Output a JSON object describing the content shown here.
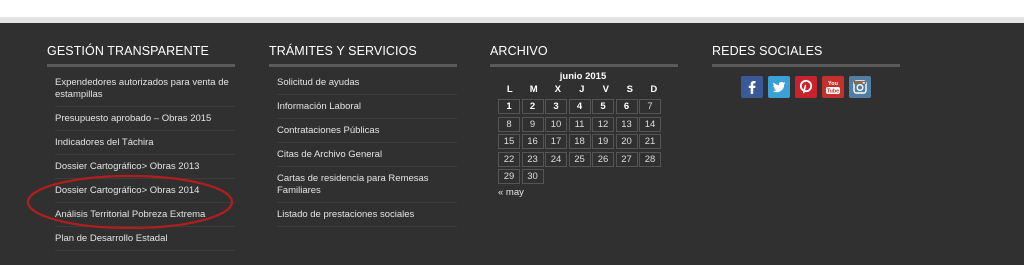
{
  "colors": {
    "footer_bg": "#303030",
    "rule": "#5a5a5a",
    "annotation": "#b21e1e",
    "facebook": "#3b5998",
    "twitter": "#3aa0d6",
    "pinterest": "#c8232c",
    "youtube": "#c4302b",
    "instagram": "#517fa4"
  },
  "gestion": {
    "title": "GESTIÓN TRANSPARENTE",
    "items": [
      "Expendedores autorizados para venta de estampillas",
      "Presupuesto aprobado – Obras 2015",
      "Indicadores del Táchira",
      "Dossier Cartográfico> Obras 2013",
      "Dossier Cartográfico> Obras 2014",
      "Análisis Territorial Pobreza Extrema",
      "Plan de Desarrollo Estadal"
    ]
  },
  "tramites": {
    "title": "TRÁMITES Y SERVICIOS",
    "items": [
      "Solicitud de ayudas",
      "Información Laboral",
      "Contrataciones Públicas",
      "Citas de Archivo General",
      "Cartas de residencia para Remesas Familiares",
      "Listado de prestaciones sociales"
    ]
  },
  "archivo": {
    "title": "ARCHIVO",
    "caption": "junio 2015",
    "weekdays": [
      "L",
      "M",
      "X",
      "J",
      "V",
      "S",
      "D"
    ],
    "days": [
      [
        "1",
        "2",
        "3",
        "4",
        "5",
        "6",
        "7"
      ],
      [
        "8",
        "9",
        "10",
        "11",
        "12",
        "13",
        "14"
      ],
      [
        "15",
        "16",
        "17",
        "18",
        "19",
        "20",
        "21"
      ],
      [
        "22",
        "23",
        "24",
        "25",
        "26",
        "27",
        "28"
      ],
      [
        "29",
        "30",
        "",
        "",
        "",
        "",
        ""
      ]
    ],
    "bold_days": [
      "1",
      "2",
      "3",
      "4",
      "5",
      "6"
    ],
    "prev_link": "« may"
  },
  "redes": {
    "title": "REDES SOCIALES",
    "icons": [
      "facebook-icon",
      "twitter-icon",
      "pinterest-icon",
      "youtube-icon",
      "instagram-icon"
    ]
  }
}
